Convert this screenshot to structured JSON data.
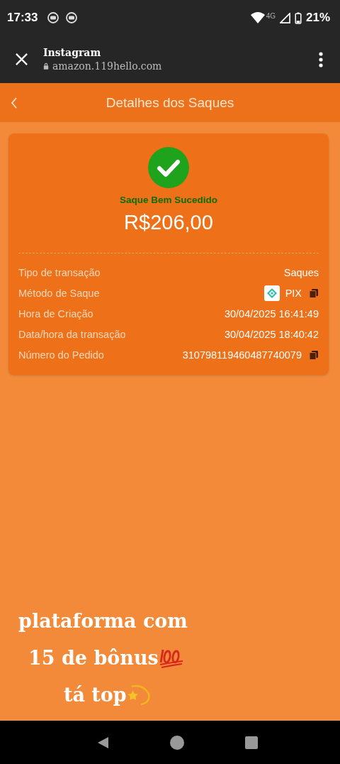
{
  "status_bar": {
    "time": "17:33",
    "network": "4G",
    "battery": "21%"
  },
  "browser_bar": {
    "title": "Instagram",
    "url": "amazon.119hello.com"
  },
  "header": {
    "title": "Detalhes dos Saques"
  },
  "card": {
    "status": "Saque Bem Sucedido",
    "amount": "R$206,00",
    "rows": [
      {
        "kind": "plain",
        "label": "Tipo de transação",
        "value": "Saques",
        "copy": false
      },
      {
        "kind": "method",
        "label": "Método de Saque",
        "value": "PIX",
        "copy": true
      },
      {
        "kind": "plain",
        "label": "Hora de Criação",
        "value": "30/04/2025 16:41:49",
        "copy": false
      },
      {
        "kind": "plain",
        "label": "Data/hora da transação",
        "value": "30/04/2025 18:40:42",
        "copy": false
      },
      {
        "kind": "plain",
        "label": "Número do Pedido",
        "value": "310798119460487740079",
        "copy": true
      }
    ]
  },
  "caption": [
    {
      "text": "plataforma com",
      "kind": "plain"
    },
    {
      "text": "15 de bônus",
      "kind": "hundred"
    },
    {
      "text": "tá top",
      "kind": "dizzy"
    }
  ]
}
